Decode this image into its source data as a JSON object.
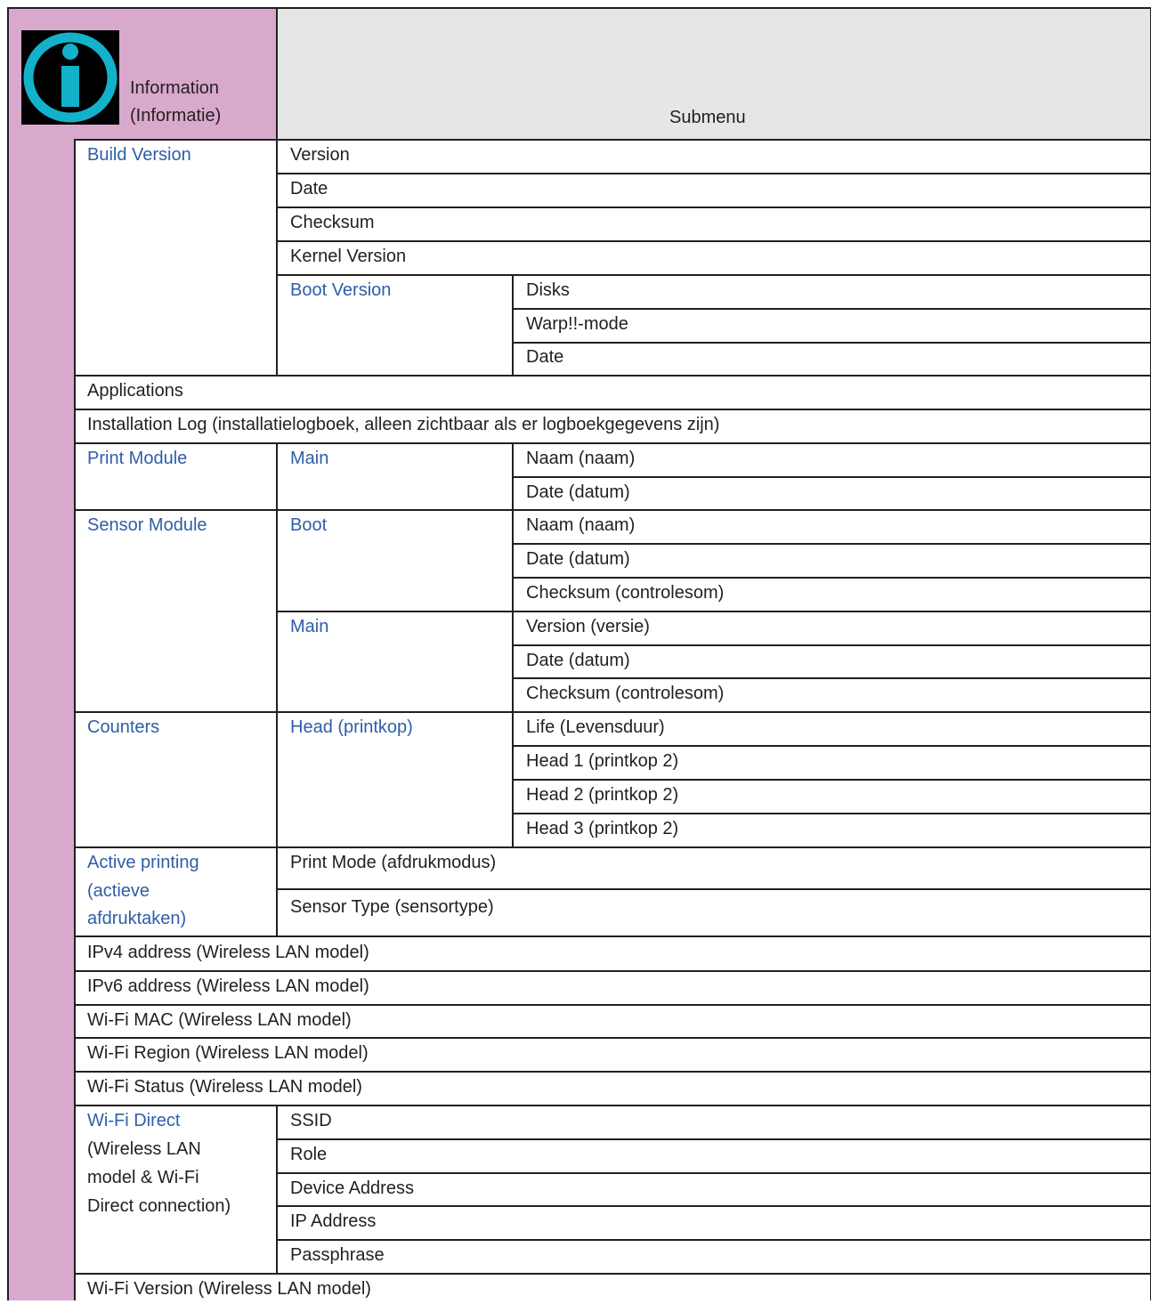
{
  "header": {
    "title_line1": "Information",
    "title_line2": "(Informatie)",
    "submenu_label": "Submenu",
    "icon": "info-icon"
  },
  "colors": {
    "sidebar": "#d9a9cd",
    "header_band": "#e6e6e7",
    "link_text": "#2e5ea8",
    "icon_cyan": "#14b2ca",
    "icon_bg": "#000000"
  },
  "rows": {
    "build_version": "Build Version",
    "version": "Version",
    "date": "Date",
    "checksum": "Checksum",
    "kernel_version": "Kernel Version",
    "boot_version": "Boot Version",
    "disks": "Disks",
    "warp_mode": "Warp!!-mode",
    "boot_date": "Date",
    "applications": "Applications",
    "installation_log": "Installation Log (installatielogboek, alleen zichtbaar als er logboekgegevens zijn)",
    "print_module": "Print Module",
    "print_main": "Main",
    "print_naam": "Naam (naam)",
    "print_date": "Date (datum)",
    "sensor_module": "Sensor Module",
    "sensor_boot": "Boot",
    "sensor_boot_naam": "Naam (naam)",
    "sensor_boot_date": "Date (datum)",
    "sensor_boot_checksum": "Checksum (controlesom)",
    "sensor_main": "Main",
    "sensor_main_version": "Version (versie)",
    "sensor_main_date": "Date (datum)",
    "sensor_main_checksum": "Checksum (controlesom)",
    "counters": "Counters",
    "head_printkop": "Head (printkop)",
    "life": "Life (Levensduur)",
    "head1": "Head 1 (printkop 2)",
    "head2": "Head 2 (printkop 2)",
    "head3": "Head 3 (printkop 2)",
    "active_printing_1": "Active printing",
    "active_printing_2": "(actieve",
    "active_printing_3": "afdruktaken)",
    "print_mode": "Print Mode (afdrukmodus)",
    "sensor_type": "Sensor Type (sensortype)",
    "ipv4": "IPv4 address (Wireless LAN model)",
    "ipv6": "IPv6 address (Wireless LAN model)",
    "wifi_mac": "Wi-Fi MAC (Wireless LAN model)",
    "wifi_region": "Wi-Fi Region (Wireless LAN model)",
    "wifi_status": "Wi-Fi Status (Wireless LAN model)",
    "wifi_direct": "Wi-Fi Direct",
    "wifi_direct_note_1": "(Wireless LAN",
    "wifi_direct_note_2": "model & Wi-Fi",
    "wifi_direct_note_3": "Direct connection)",
    "ssid": "SSID",
    "role": "Role",
    "device_address": "Device Address",
    "ip_address": "IP Address",
    "passphrase": "Passphrase",
    "wifi_version": "Wi-Fi Version (Wireless LAN model)"
  }
}
